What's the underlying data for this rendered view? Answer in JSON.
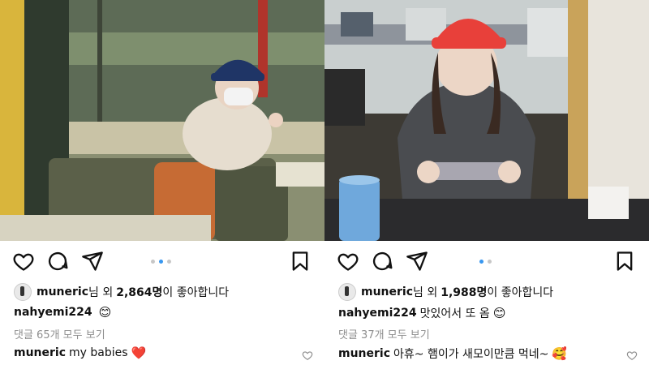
{
  "posts": [
    {
      "liked_by_user": "muneric",
      "likes_prefix": "님 외 ",
      "likes_count": "2,864명",
      "likes_suffix": "이 좋아합니다",
      "caption_user": "nahyemi224",
      "caption_text": "",
      "caption_emoji": "😊",
      "comments_link": "댓글 65개 모두 보기",
      "comment_user": "muneric",
      "comment_text": "my babies",
      "comment_emoji": "❤️",
      "carousel": {
        "count": 3,
        "active": 1
      },
      "photo_icon": "photo-cafe-booth-icon"
    },
    {
      "liked_by_user": "muneric",
      "likes_prefix": "님 외 ",
      "likes_count": "1,988명",
      "likes_suffix": "이 좋아합니다",
      "caption_user": "nahyemi224",
      "caption_text": "맛있어서 또 옴",
      "caption_emoji": "😊",
      "comments_link": "댓글 37개 모두 보기",
      "comment_user": "muneric",
      "comment_text": "아휴~ 햄이가 새모이만큼 먹네~",
      "comment_emoji": "🥰",
      "carousel": {
        "count": 2,
        "active": 0
      },
      "photo_icon": "photo-phone-gaming-icon"
    }
  ],
  "colors": {
    "accent_dot": "#3897f0",
    "muted_text": "#8e8e8e",
    "cap_red": "#e8403a",
    "cap_navy": "#1f3566"
  }
}
